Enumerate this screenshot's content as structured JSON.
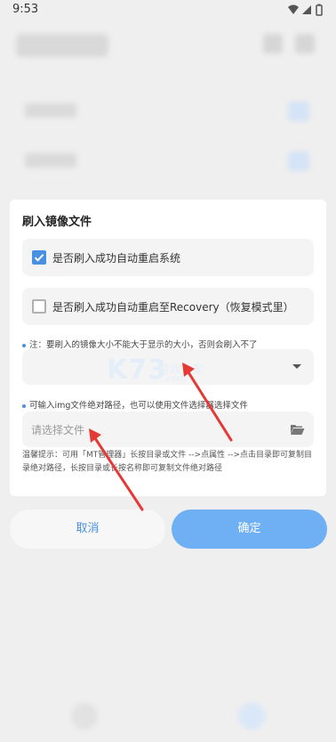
{
  "status_bar": {
    "time": "9:53"
  },
  "dialog": {
    "title": "刷入镜像文件",
    "options": [
      {
        "label": "是否刷入成功自动重启系统",
        "checked": true
      },
      {
        "label": "是否刷入成功自动重启至Recovery（恢复模式里）",
        "checked": false
      }
    ],
    "note_size": "注：要刷入的镜像大小不能大于显示的大小，否则会刷入不了",
    "note_path": "可输入img文件绝对路径，也可以使用文件选择器选择文件",
    "file_input_placeholder": "请选择文件",
    "hint": "温馨提示：可用「MT管理器」长按目录或文件 -->点属性 -->点击目录即可复制目录绝对路径，长按目录或长按名称即可复制文件绝对路径"
  },
  "watermark": {
    "text": "K73",
    "subtext": "游戏之家",
    "domain": ".com"
  },
  "buttons": {
    "cancel": "取消",
    "confirm": "确定"
  },
  "icons": {
    "checkbox_checked": "check-icon",
    "dropdown": "caret-down-icon",
    "folder": "folder-open-icon",
    "wifi": "wifi-icon",
    "signal": "signal-icon",
    "battery": "battery-icon"
  },
  "colors": {
    "accent": "#4a90e2",
    "confirm_bg": "#6fb0f5",
    "annotation": "#e53935"
  }
}
